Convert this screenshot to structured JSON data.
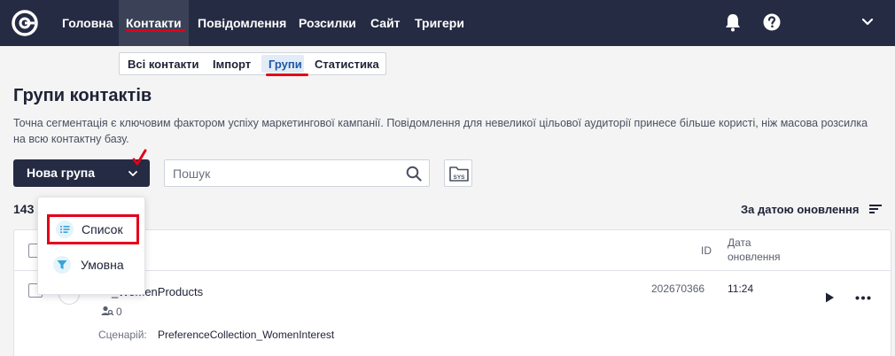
{
  "nav": {
    "items": [
      "Головна",
      "Контакти",
      "Повідомлення",
      "Розсилки",
      "Сайт",
      "Тригери"
    ]
  },
  "subtabs": [
    "Всі контакти",
    "Імпорт",
    "Групи",
    "Статистика"
  ],
  "page": {
    "title": "Групи контактів",
    "description": "Точна сегментація є ключовим фактором успіху маркетингової кампанії. Повідомлення для невеликої цільової аудиторії принесе більше користі, ніж масова розсилка на всю контактну базу."
  },
  "toolbar": {
    "new_group_label": "Нова група",
    "search_placeholder": "Пошук",
    "folder_label": "SYS"
  },
  "list": {
    "count_partial": "143",
    "sort_label": "За датою оновлення",
    "columns": {
      "id": "ID",
      "date_line1": "Дата",
      "date_line2": "оновлення"
    },
    "rows": [
      {
        "name": "_WomenProducts",
        "contacts": "0",
        "scenario_label": "Сценарій:",
        "scenario": "PreferenceCollection_WomenInterest",
        "id": "202670366",
        "updated": "11:24"
      }
    ]
  },
  "dropdown": {
    "items": [
      {
        "label": "Список",
        "icon": "list-icon"
      },
      {
        "label": "Умовна",
        "icon": "filter-icon"
      }
    ]
  },
  "colors": {
    "nav_bg": "#252b43",
    "accent_red": "#e2001a",
    "active_tab": "#1e5aa8"
  }
}
